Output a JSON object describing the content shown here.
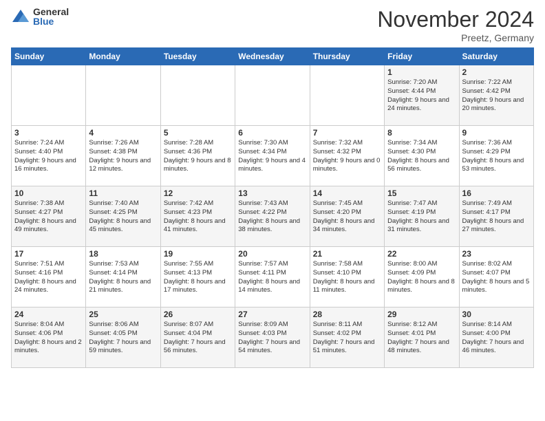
{
  "header": {
    "logo_general": "General",
    "logo_blue": "Blue",
    "month_title": "November 2024",
    "location": "Preetz, Germany"
  },
  "weekdays": [
    "Sunday",
    "Monday",
    "Tuesday",
    "Wednesday",
    "Thursday",
    "Friday",
    "Saturday"
  ],
  "weeks": [
    [
      {
        "day": "",
        "info": ""
      },
      {
        "day": "",
        "info": ""
      },
      {
        "day": "",
        "info": ""
      },
      {
        "day": "",
        "info": ""
      },
      {
        "day": "",
        "info": ""
      },
      {
        "day": "1",
        "info": "Sunrise: 7:20 AM\nSunset: 4:44 PM\nDaylight: 9 hours\nand 24 minutes."
      },
      {
        "day": "2",
        "info": "Sunrise: 7:22 AM\nSunset: 4:42 PM\nDaylight: 9 hours\nand 20 minutes."
      }
    ],
    [
      {
        "day": "3",
        "info": "Sunrise: 7:24 AM\nSunset: 4:40 PM\nDaylight: 9 hours\nand 16 minutes."
      },
      {
        "day": "4",
        "info": "Sunrise: 7:26 AM\nSunset: 4:38 PM\nDaylight: 9 hours\nand 12 minutes."
      },
      {
        "day": "5",
        "info": "Sunrise: 7:28 AM\nSunset: 4:36 PM\nDaylight: 9 hours\nand 8 minutes."
      },
      {
        "day": "6",
        "info": "Sunrise: 7:30 AM\nSunset: 4:34 PM\nDaylight: 9 hours\nand 4 minutes."
      },
      {
        "day": "7",
        "info": "Sunrise: 7:32 AM\nSunset: 4:32 PM\nDaylight: 9 hours\nand 0 minutes."
      },
      {
        "day": "8",
        "info": "Sunrise: 7:34 AM\nSunset: 4:30 PM\nDaylight: 8 hours\nand 56 minutes."
      },
      {
        "day": "9",
        "info": "Sunrise: 7:36 AM\nSunset: 4:29 PM\nDaylight: 8 hours\nand 53 minutes."
      }
    ],
    [
      {
        "day": "10",
        "info": "Sunrise: 7:38 AM\nSunset: 4:27 PM\nDaylight: 8 hours\nand 49 minutes."
      },
      {
        "day": "11",
        "info": "Sunrise: 7:40 AM\nSunset: 4:25 PM\nDaylight: 8 hours\nand 45 minutes."
      },
      {
        "day": "12",
        "info": "Sunrise: 7:42 AM\nSunset: 4:23 PM\nDaylight: 8 hours\nand 41 minutes."
      },
      {
        "day": "13",
        "info": "Sunrise: 7:43 AM\nSunset: 4:22 PM\nDaylight: 8 hours\nand 38 minutes."
      },
      {
        "day": "14",
        "info": "Sunrise: 7:45 AM\nSunset: 4:20 PM\nDaylight: 8 hours\nand 34 minutes."
      },
      {
        "day": "15",
        "info": "Sunrise: 7:47 AM\nSunset: 4:19 PM\nDaylight: 8 hours\nand 31 minutes."
      },
      {
        "day": "16",
        "info": "Sunrise: 7:49 AM\nSunset: 4:17 PM\nDaylight: 8 hours\nand 27 minutes."
      }
    ],
    [
      {
        "day": "17",
        "info": "Sunrise: 7:51 AM\nSunset: 4:16 PM\nDaylight: 8 hours\nand 24 minutes."
      },
      {
        "day": "18",
        "info": "Sunrise: 7:53 AM\nSunset: 4:14 PM\nDaylight: 8 hours\nand 21 minutes."
      },
      {
        "day": "19",
        "info": "Sunrise: 7:55 AM\nSunset: 4:13 PM\nDaylight: 8 hours\nand 17 minutes."
      },
      {
        "day": "20",
        "info": "Sunrise: 7:57 AM\nSunset: 4:11 PM\nDaylight: 8 hours\nand 14 minutes."
      },
      {
        "day": "21",
        "info": "Sunrise: 7:58 AM\nSunset: 4:10 PM\nDaylight: 8 hours\nand 11 minutes."
      },
      {
        "day": "22",
        "info": "Sunrise: 8:00 AM\nSunset: 4:09 PM\nDaylight: 8 hours\nand 8 minutes."
      },
      {
        "day": "23",
        "info": "Sunrise: 8:02 AM\nSunset: 4:07 PM\nDaylight: 8 hours\nand 5 minutes."
      }
    ],
    [
      {
        "day": "24",
        "info": "Sunrise: 8:04 AM\nSunset: 4:06 PM\nDaylight: 8 hours\nand 2 minutes."
      },
      {
        "day": "25",
        "info": "Sunrise: 8:06 AM\nSunset: 4:05 PM\nDaylight: 7 hours\nand 59 minutes."
      },
      {
        "day": "26",
        "info": "Sunrise: 8:07 AM\nSunset: 4:04 PM\nDaylight: 7 hours\nand 56 minutes."
      },
      {
        "day": "27",
        "info": "Sunrise: 8:09 AM\nSunset: 4:03 PM\nDaylight: 7 hours\nand 54 minutes."
      },
      {
        "day": "28",
        "info": "Sunrise: 8:11 AM\nSunset: 4:02 PM\nDaylight: 7 hours\nand 51 minutes."
      },
      {
        "day": "29",
        "info": "Sunrise: 8:12 AM\nSunset: 4:01 PM\nDaylight: 7 hours\nand 48 minutes."
      },
      {
        "day": "30",
        "info": "Sunrise: 8:14 AM\nSunset: 4:00 PM\nDaylight: 7 hours\nand 46 minutes."
      }
    ]
  ]
}
